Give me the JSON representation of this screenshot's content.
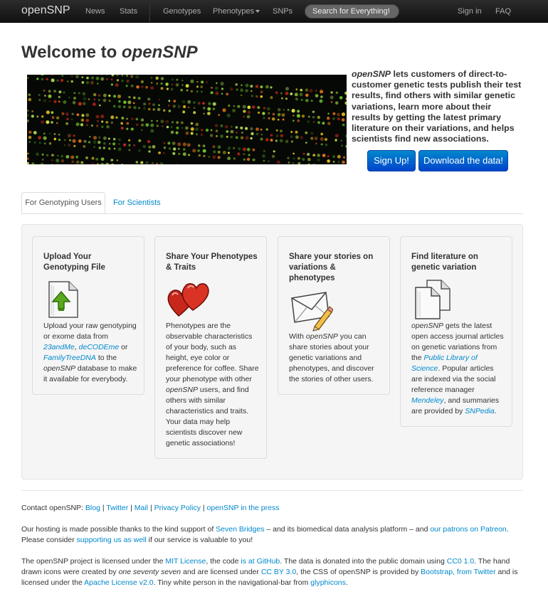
{
  "navbar": {
    "brand": "openSNP",
    "items": [
      "News",
      "Stats",
      "Genotypes",
      "Phenotypes",
      "SNPs"
    ],
    "search_placeholder": "Search for Everything!",
    "right": [
      "Sign in",
      "FAQ"
    ]
  },
  "welcome": {
    "prefix": "Welcome to ",
    "name": "openSNP"
  },
  "intro": {
    "name": "openSNP",
    "text": " lets customers of direct-to-customer genetic tests publish their test results, find others with similar genetic variations, learn more about their results by getting the latest primary literature on their variations, and helps scientists find new associations."
  },
  "buttons": {
    "signup": "Sign Up!",
    "download": "Download the data!"
  },
  "tabs": {
    "active": "For Genotyping Users",
    "other": "For Scientists"
  },
  "cards": [
    {
      "title": "Upload Your Genotyping File",
      "icon": "upload-file-icon",
      "body": [
        {
          "t": "Upload your raw genotyping or exome data from "
        },
        {
          "t": "23andMe",
          "link": true,
          "italic": true
        },
        {
          "t": ", "
        },
        {
          "t": "deCODEme",
          "link": true,
          "italic": true
        },
        {
          "t": " or "
        },
        {
          "t": "FamilyTreeDNA",
          "link": true,
          "italic": true
        },
        {
          "t": " to the "
        },
        {
          "t": "openSNP",
          "italic": true
        },
        {
          "t": " database to make it available for everybody."
        }
      ]
    },
    {
      "title": "Share Your Phenotypes & Traits",
      "icon": "hearts-icon",
      "body": [
        {
          "t": "Phenotypes are the observable characteristics of your body, such as height, eye color or preference for coffee. Share your phenotype with other "
        },
        {
          "t": "openSNP",
          "italic": true
        },
        {
          "t": " users, and find others with similar characteristics and traits. Your data may help scientists discover new genetic associations!"
        }
      ]
    },
    {
      "title": "Share your stories on variations & phenotypes",
      "icon": "envelope-pencil-icon",
      "body": [
        {
          "t": "With "
        },
        {
          "t": "openSNP",
          "italic": true
        },
        {
          "t": " you can share stories about your genetic variations and phenotypes, and discover the stories of other users."
        }
      ]
    },
    {
      "title": "Find literature on genetic variation",
      "icon": "documents-icon",
      "body": [
        {
          "t": "openSNP",
          "italic": true
        },
        {
          "t": " gets the latest open access journal articles on genetic variations from the "
        },
        {
          "t": "Public Library of Science",
          "link": true,
          "italic": true
        },
        {
          "t": ". Popular articles are indexed via the social reference manager "
        },
        {
          "t": "Mendeley",
          "link": true,
          "italic": true
        },
        {
          "t": ", and summaries are provided by "
        },
        {
          "t": "SNPedia",
          "link": true,
          "italic": true
        },
        {
          "t": "."
        }
      ]
    }
  ],
  "footer": {
    "contact": [
      {
        "t": "Contact openSNP: "
      },
      {
        "t": "Blog",
        "link": true
      },
      {
        "t": " | "
      },
      {
        "t": "Twitter",
        "link": true
      },
      {
        "t": " | "
      },
      {
        "t": "Mail",
        "link": true
      },
      {
        "t": " | "
      },
      {
        "t": "Privacy Policy",
        "link": true
      },
      {
        "t": " | "
      },
      {
        "t": "openSNP in the press",
        "link": true
      }
    ],
    "hosting": [
      {
        "t": "Our hosting is made possible thanks to the kind support of "
      },
      {
        "t": "Seven Bridges",
        "link": true
      },
      {
        "t": " – and its biomedical data analysis platform – and "
      },
      {
        "t": "our patrons on Patreon",
        "link": true
      },
      {
        "t": ". Please consider "
      },
      {
        "t": "supporting us as well",
        "link": true
      },
      {
        "t": " if our service is valuable to you!"
      }
    ],
    "license": [
      {
        "t": "The openSNP project is licensed under the "
      },
      {
        "t": "MIT License",
        "link": true
      },
      {
        "t": ", the code "
      },
      {
        "t": "is at GitHub",
        "link": true
      },
      {
        "t": ". The data is donated into the public domain using "
      },
      {
        "t": "CC0 1.0",
        "link": true
      },
      {
        "t": ". The hand drawn icons were created by "
      },
      {
        "t": "one seventy seven",
        "italic": true
      },
      {
        "t": " and are licensed under "
      },
      {
        "t": "CC BY 3.0",
        "link": true
      },
      {
        "t": ", the CSS of openSNP is provided by "
      },
      {
        "t": "Bootstrap, from Twitter",
        "link": true
      },
      {
        "t": " and is licensed under the "
      },
      {
        "t": "Apache License v2.0",
        "link": true
      },
      {
        "t": ". Tiny white person in the navigational-bar from "
      },
      {
        "t": "glyphicons",
        "link": true
      },
      {
        "t": "."
      }
    ]
  }
}
